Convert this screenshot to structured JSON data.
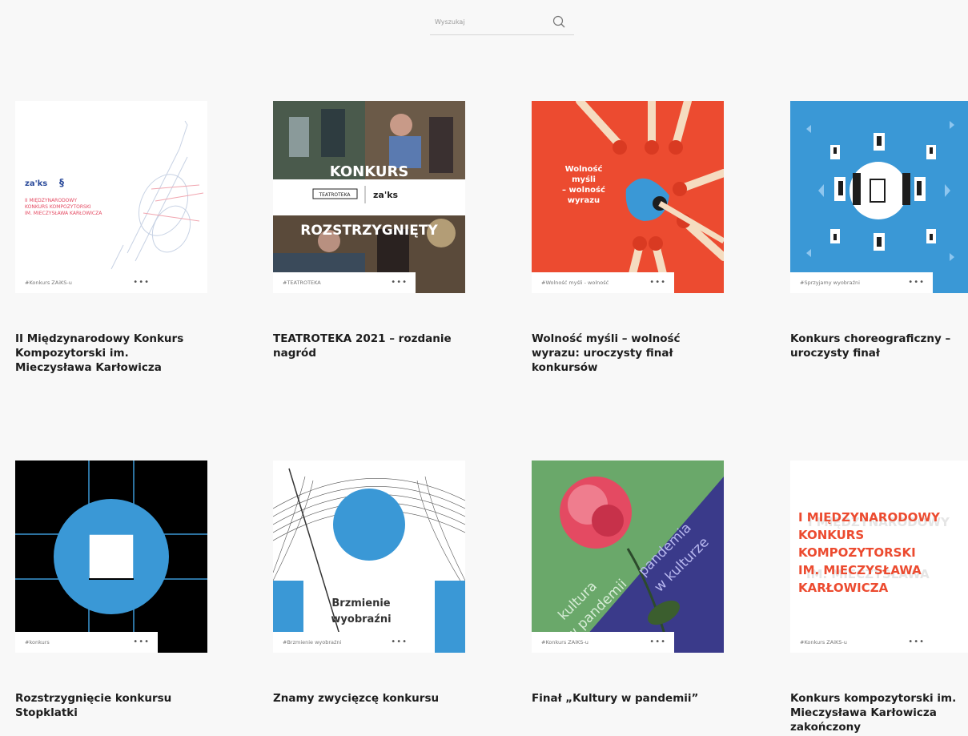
{
  "search": {
    "placeholder": "Wyszukaj"
  },
  "cards": [
    {
      "tag": "#Konkurs ZAiKS-u",
      "title": "II Międzynarodowy Konkurs Kompozytorski im. Mieczysława Karłowicza",
      "img_text": {
        "line1": "II MIĘDZYNARODOWY",
        "line2": "KONKURS KOMPOZYTORSKI",
        "line3": "IM. MIECZYSŁAWA KARŁOWICZA",
        "logo": "za'ks"
      }
    },
    {
      "tag": "#TEATROTEKA",
      "title": "TEATROTEKA 2021 – rozdanie nagród",
      "img_text": {
        "top": "KONKURS",
        "bottom": "ROZSTRZYGNIĘTY",
        "logo1": "TEATROTEKA",
        "logo2": "za'ks"
      }
    },
    {
      "tag": "#Wolność myśli - wolność",
      "title": "Wolność myśli – wolność wyrazu: uroczysty finał konkursów",
      "img_text": {
        "line1": "Wolność",
        "line2": "myśli",
        "line3": "– wolność",
        "line4": "wyrazu"
      }
    },
    {
      "tag": "#Sprzyjamy wyobraźni",
      "title": "Konkurs choreograficzny – uroczysty finał"
    },
    {
      "tag": "#konkurs",
      "title": "Rozstrzygnięcie konkursu Stopklatki"
    },
    {
      "tag": "#Brzmienie wyobraźni",
      "title": "Znamy zwycięzcę konkursu",
      "img_text": {
        "line1": "Brzmienie",
        "line2": "wyobraźni"
      }
    },
    {
      "tag": "#Konkurs ZAiKS-u",
      "title": "Finał „Kultury w pandemii”",
      "img_text": {
        "left1": "kultura",
        "left2": "w pandemii",
        "right1": "pandemia",
        "right2": "w kulturze"
      }
    },
    {
      "tag": "#Konkurs ZAiKS-u",
      "title": "Konkurs kompozytorski im. Mieczysława Karłowicza zakończony",
      "img_text": {
        "line1": "I MIĘDZYNARODOWY",
        "line2": "KONKURS",
        "line3": "KOMPOZYTORSKI",
        "line4": "IM. MIECZYSŁAWA",
        "line5": "KARŁOWICZA"
      }
    }
  ],
  "colors": {
    "red": "#ec4b30",
    "blue": "#3a98d6",
    "pink": "#e44a62",
    "green": "#6aa86a",
    "navy": "#3a3a8a"
  }
}
